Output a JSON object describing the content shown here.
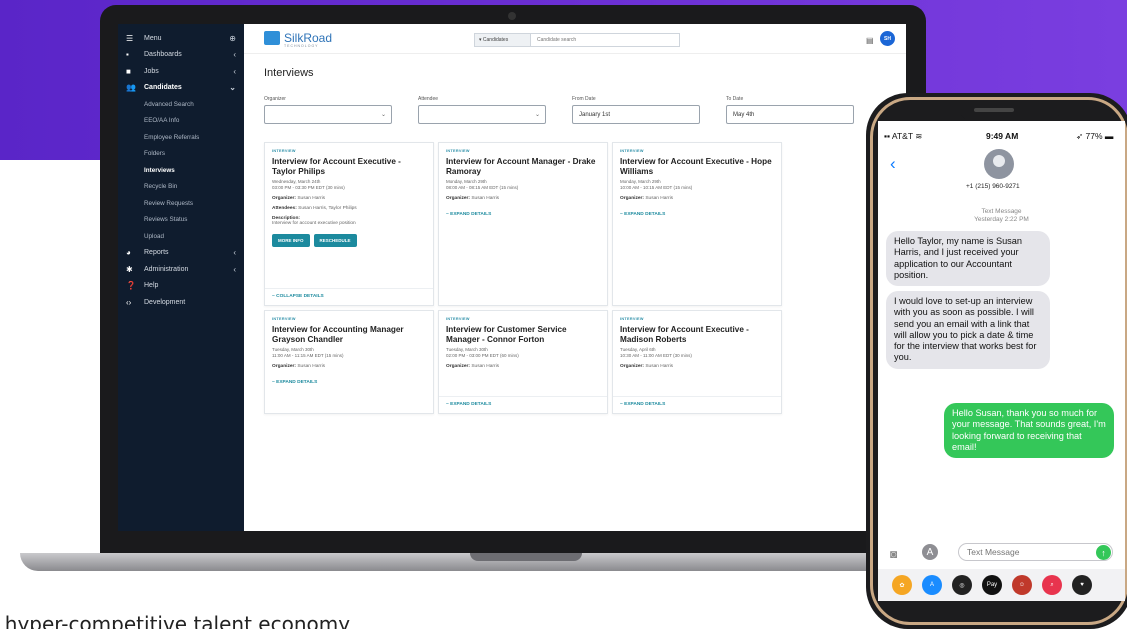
{
  "sidebar": {
    "items": [
      {
        "label": "Menu",
        "icon": "hamburger-icon",
        "has_plus": true
      },
      {
        "label": "Dashboards",
        "icon": "dashboard-icon"
      },
      {
        "label": "Jobs",
        "icon": "briefcase-icon"
      },
      {
        "label": "Candidates",
        "icon": "people-icon",
        "expanded": true
      }
    ],
    "sub_items": [
      "Advanced Search",
      "EEO/AA Info",
      "Employee Referrals",
      "Folders",
      "Interviews",
      "Recycle Bin",
      "Review Requests",
      "Reviews Status",
      "Upload"
    ],
    "active_sub": "Interviews",
    "bottom_items": [
      {
        "label": "Reports",
        "icon": "pie-chart-icon"
      },
      {
        "label": "Administration",
        "icon": "gear-icon"
      },
      {
        "label": "Help",
        "icon": "help-icon"
      },
      {
        "label": "Development",
        "icon": "code-icon"
      }
    ]
  },
  "header": {
    "logo_text": "SilkRoad",
    "logo_sub": "TECHNOLOGY",
    "search_scope": "Candidates",
    "search_placeholder": "Candidate search",
    "avatar_initials": "SH"
  },
  "page": {
    "title": "Interviews",
    "filters": {
      "organizer_label": "Organizer",
      "attendee_label": "Attendee",
      "from_label": "From Date",
      "from_value": "January 1st",
      "to_label": "To Date",
      "to_value": "May 4th"
    }
  },
  "cards": [
    {
      "tag": "INTERVIEW",
      "title": "Interview for Account Executive - Taylor Philips",
      "date": "Wednesday, March 24th",
      "time": "03:00 PM - 03:30 PM EDT (30 mins)",
      "organizer": "Susan Harris",
      "attendees": "Susan Harris, Taylor Philips",
      "description": "Interview for account executive position",
      "more_info": "MORE INFO",
      "reschedule": "RESCHEDULE",
      "toggle": "~ COLLAPSE DETAILS"
    },
    {
      "tag": "INTERVIEW",
      "title": "Interview for Account Manager - Drake Ramoray",
      "date": "Monday, March 29th",
      "time": "08:00 AM - 08:15 AM EDT (15 mins)",
      "organizer": "Susan Harris",
      "toggle": "~ EXPAND DETAILS"
    },
    {
      "tag": "INTERVIEW",
      "title": "Interview for Account Executive - Hope Williams",
      "date": "Monday, March 29th",
      "time": "10:00 AM - 10:15 AM EDT (15 mins)",
      "organizer": "Susan Harris",
      "toggle": "~ EXPAND DETAILS"
    },
    {
      "tag": "INTERVIEW",
      "title": "Interview for Accounting Manager Grayson Chandler",
      "date": "Tuesday, March 30th",
      "time": "11:00 AM - 11:15 AM EDT (15 mins)",
      "organizer": "Susan Harris",
      "toggle": "~ EXPAND DETAILS"
    },
    {
      "tag": "INTERVIEW",
      "title": "Interview for Customer Service Manager - Connor Forton",
      "date": "Tuesday, March 30th",
      "time": "02:00 PM - 03:00 PM EDT (60 mins)",
      "organizer": "Susan Harris",
      "toggle": "~ EXPAND DETAILS"
    },
    {
      "tag": "INTERVIEW",
      "title": "Interview for Account Executive - Madison Roberts",
      "date": "Tuesday, April 6th",
      "time": "10:30 AM - 11:00 AM EDT (30 mins)",
      "organizer": "Susan Harris",
      "toggle": "~ EXPAND DETAILS"
    }
  ],
  "labels": {
    "organizer": "Organizer:",
    "attendees": "Attendees:",
    "description": "Description:"
  },
  "phone": {
    "carrier": "AT&T",
    "time": "9:49 AM",
    "battery": "77%",
    "contact": "+1 (215) 960-9271",
    "meta_line1": "Text Message",
    "meta_line2": "Yesterday 2:22 PM",
    "messages": [
      {
        "from": "in",
        "text": "Hello Taylor, my name is Susan Harris, and I just received your application to our Accountant position."
      },
      {
        "from": "in",
        "text": "I would love to set-up an interview with you as soon as possible. I will send you an email with a link that will allow you to pick a date & time for the interview that works best for you."
      },
      {
        "from": "out",
        "text": "Hello Susan, thank you so much for your message. That sounds great, I'm looking forward to receiving that email!"
      }
    ],
    "compose_placeholder": "Text Message"
  },
  "tagline": "s hyper-competitive talent economy",
  "colors": {
    "brand_purple": "#6a34d6",
    "teal": "#1c8a9e",
    "imessage_green": "#34c759",
    "sidebar": "#0f1c2e"
  }
}
